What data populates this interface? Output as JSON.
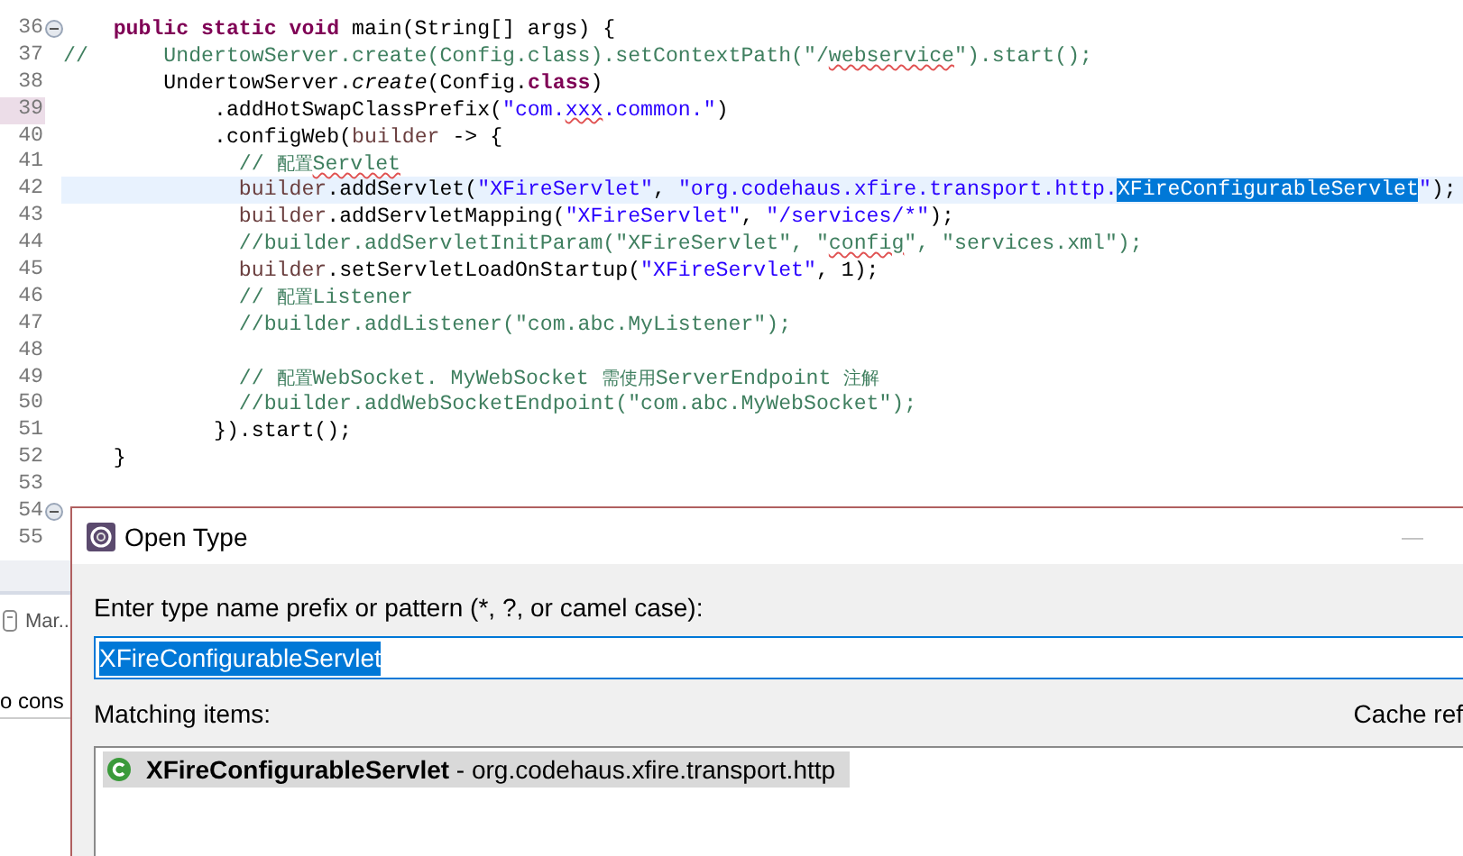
{
  "editor": {
    "lines": [
      {
        "number": "36",
        "foldable": true,
        "current": false,
        "changed": false,
        "tokens": [
          {
            "t": "    public static void",
            "kind": "kw"
          },
          {
            "t": " main(String[] args) {",
            "kind": "plain"
          }
        ]
      },
      {
        "number": "37",
        "foldable": false,
        "current": false,
        "changed": false,
        "tokens": [
          {
            "t": "//      UndertowServer.create(Config.class).setContextPath(\"/",
            "kind": "comment"
          },
          {
            "t": "webservice",
            "kind": "comment",
            "misspelled": true
          },
          {
            "t": "\").start();",
            "kind": "comment"
          }
        ]
      },
      {
        "number": "38",
        "foldable": false,
        "current": false,
        "changed": false,
        "tokens": [
          {
            "t": "        UndertowServer.",
            "kind": "plain"
          },
          {
            "t": "create",
            "kind": "static"
          },
          {
            "t": "(Config.",
            "kind": "plain"
          },
          {
            "t": "class",
            "kind": "kw"
          },
          {
            "t": ")",
            "kind": "plain"
          }
        ]
      },
      {
        "number": "39",
        "foldable": false,
        "current": false,
        "changed": true,
        "tokens": [
          {
            "t": "            .addHotSwapClassPrefix(",
            "kind": "plain"
          },
          {
            "t": "\"com.",
            "kind": "string"
          },
          {
            "t": "xxx",
            "kind": "string",
            "misspelled": true
          },
          {
            "t": ".common.\"",
            "kind": "string"
          },
          {
            "t": ")",
            "kind": "plain"
          }
        ]
      },
      {
        "number": "40",
        "foldable": false,
        "current": false,
        "changed": false,
        "tokens": [
          {
            "t": "            .configWeb(",
            "kind": "plain"
          },
          {
            "t": "builder",
            "kind": "var"
          },
          {
            "t": " -> {",
            "kind": "plain"
          }
        ]
      },
      {
        "number": "41",
        "foldable": false,
        "current": false,
        "changed": false,
        "tokens": [
          {
            "t": "              // ",
            "kind": "comment"
          },
          {
            "t": "配置",
            "kind": "cjk"
          },
          {
            "t": "Servlet",
            "kind": "comment",
            "misspelled": true
          }
        ]
      },
      {
        "number": "42",
        "foldable": false,
        "current": true,
        "changed": false,
        "tokens": [
          {
            "t": "              builder",
            "kind": "var"
          },
          {
            "t": ".addServlet(",
            "kind": "plain"
          },
          {
            "t": "\"XFireServlet\"",
            "kind": "string"
          },
          {
            "t": ", ",
            "kind": "plain"
          },
          {
            "t": "\"org.codehaus.xfire.transport.http.",
            "kind": "string"
          },
          {
            "t": "XFireConfigurableServlet",
            "kind": "selected"
          },
          {
            "t": "\"",
            "kind": "string"
          },
          {
            "t": ");",
            "kind": "plain"
          }
        ]
      },
      {
        "number": "43",
        "foldable": false,
        "current": false,
        "changed": false,
        "tokens": [
          {
            "t": "              builder",
            "kind": "var"
          },
          {
            "t": ".addServletMapping(",
            "kind": "plain"
          },
          {
            "t": "\"XFireServlet\"",
            "kind": "string"
          },
          {
            "t": ", ",
            "kind": "plain"
          },
          {
            "t": "\"/services/*\"",
            "kind": "string"
          },
          {
            "t": ");",
            "kind": "plain"
          }
        ]
      },
      {
        "number": "44",
        "foldable": false,
        "current": false,
        "changed": false,
        "tokens": [
          {
            "t": "              //builder.addServletInitParam(\"XFireServlet\", \"",
            "kind": "comment"
          },
          {
            "t": "config",
            "kind": "comment",
            "misspelled": true
          },
          {
            "t": "\", \"services.xml\");",
            "kind": "comment"
          }
        ]
      },
      {
        "number": "45",
        "foldable": false,
        "current": false,
        "changed": false,
        "tokens": [
          {
            "t": "              builder",
            "kind": "var"
          },
          {
            "t": ".setServletLoadOnStartup(",
            "kind": "plain"
          },
          {
            "t": "\"XFireServlet\"",
            "kind": "string"
          },
          {
            "t": ", 1);",
            "kind": "plain"
          }
        ]
      },
      {
        "number": "46",
        "foldable": false,
        "current": false,
        "changed": false,
        "tokens": [
          {
            "t": "              // ",
            "kind": "comment"
          },
          {
            "t": "配置",
            "kind": "cjk"
          },
          {
            "t": "Listener",
            "kind": "comment"
          }
        ]
      },
      {
        "number": "47",
        "foldable": false,
        "current": false,
        "changed": false,
        "tokens": [
          {
            "t": "              //builder.addListener(\"com.abc.MyListener\");",
            "kind": "comment"
          }
        ]
      },
      {
        "number": "48",
        "foldable": false,
        "current": false,
        "changed": false
      },
      {
        "number": "49",
        "foldable": false,
        "current": false,
        "changed": false,
        "tokens": [
          {
            "t": "              // ",
            "kind": "comment"
          },
          {
            "t": "配置",
            "kind": "cjk"
          },
          {
            "t": "WebSocket. MyWebSocket ",
            "kind": "comment"
          },
          {
            "t": "需使用",
            "kind": "cjk"
          },
          {
            "t": "ServerEndpoint ",
            "kind": "comment"
          },
          {
            "t": "注解",
            "kind": "cjk"
          }
        ]
      },
      {
        "number": "50",
        "foldable": false,
        "current": false,
        "changed": false,
        "tokens": [
          {
            "t": "              //builder.addWebSocketEndpoint(\"com.abc.MyWebSocket\");",
            "kind": "comment"
          }
        ]
      },
      {
        "number": "51",
        "foldable": false,
        "current": false,
        "changed": false,
        "tokens": [
          {
            "t": "            }).start();",
            "kind": "plain"
          }
        ]
      },
      {
        "number": "52",
        "foldable": false,
        "current": false,
        "changed": false,
        "tokens": [
          {
            "t": "    }",
            "kind": "plain"
          }
        ]
      },
      {
        "number": "53",
        "foldable": false,
        "current": false,
        "changed": false
      },
      {
        "number": "54",
        "foldable": true,
        "current": false,
        "changed": false
      },
      {
        "number": "55",
        "foldable": false,
        "current": false,
        "changed": false
      }
    ]
  },
  "panel": {
    "tab": "Mar..",
    "console": "o cons"
  },
  "dialog": {
    "title": "Open Type",
    "minimize": "—",
    "prompt": "Enter type name prefix or pattern (*, ?, or camel case):",
    "input": "XFireConfigurableServlet",
    "matching_label": "Matching items:",
    "cache_label": "Cache ref",
    "items": [
      {
        "name": "XFireConfigurableServlet",
        "package": " - org.codehaus.xfire.transport.http",
        "selected": true
      }
    ]
  }
}
